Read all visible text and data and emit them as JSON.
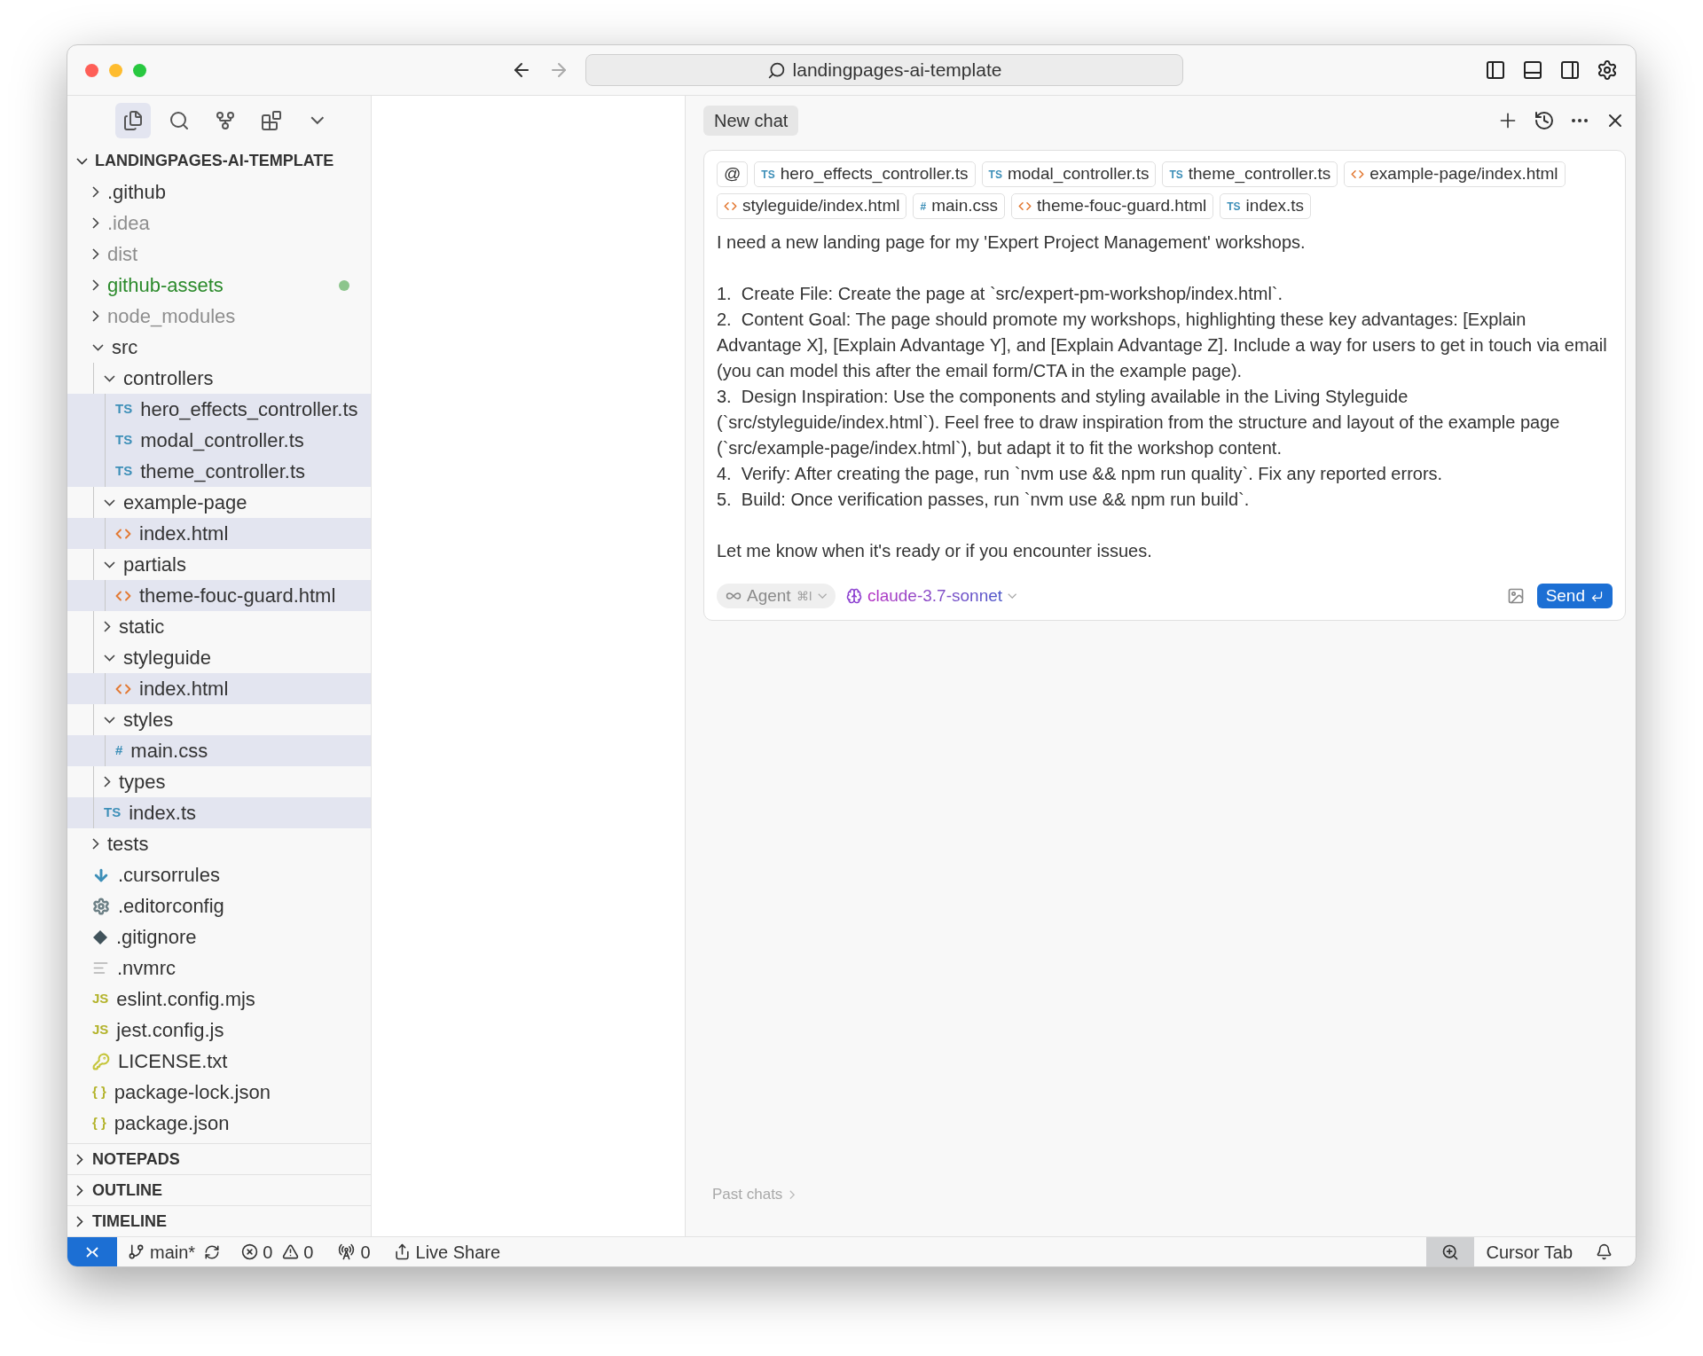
{
  "window": {
    "title": "landingpages-ai-template"
  },
  "activity_bar": [
    {
      "selected": true
    },
    {
      "selected": false
    },
    {
      "selected": false
    },
    {
      "selected": false
    },
    {
      "selected": false
    }
  ],
  "explorer": {
    "title": "LANDINGPAGES-AI-TEMPLATE",
    "expanded": true,
    "tree": [
      {
        "name": ".github",
        "kind": "folder",
        "expanded": false,
        "selected": false,
        "ignored": false,
        "untracked": false
      },
      {
        "name": ".idea",
        "kind": "folder",
        "expanded": false,
        "selected": false,
        "ignored": true,
        "untracked": false
      },
      {
        "name": "dist",
        "kind": "folder",
        "expanded": false,
        "selected": false,
        "ignored": true,
        "untracked": false
      },
      {
        "name": "github-assets",
        "kind": "folder",
        "expanded": false,
        "selected": false,
        "ignored": false,
        "untracked": true
      },
      {
        "name": "node_modules",
        "kind": "folder",
        "expanded": false,
        "selected": false,
        "ignored": true,
        "untracked": false
      },
      {
        "name": "src",
        "kind": "folder",
        "expanded": true,
        "selected": false,
        "ignored": false,
        "untracked": false,
        "children": [
          {
            "name": "controllers",
            "kind": "folder",
            "expanded": true,
            "selected": false,
            "children": [
              {
                "name": "hero_effects_controller.ts",
                "kind": "ts",
                "badge": "TS",
                "selected": true
              },
              {
                "name": "modal_controller.ts",
                "kind": "ts",
                "badge": "TS",
                "selected": true
              },
              {
                "name": "theme_controller.ts",
                "kind": "ts",
                "badge": "TS",
                "selected": true
              }
            ]
          },
          {
            "name": "example-page",
            "kind": "folder",
            "expanded": true,
            "selected": false,
            "children": [
              {
                "name": "index.html",
                "kind": "html",
                "selected": true
              }
            ]
          },
          {
            "name": "partials",
            "kind": "folder",
            "expanded": true,
            "selected": false,
            "children": [
              {
                "name": "theme-fouc-guard.html",
                "kind": "html",
                "selected": true
              }
            ]
          },
          {
            "name": "static",
            "kind": "folder",
            "expanded": false,
            "selected": false
          },
          {
            "name": "styleguide",
            "kind": "folder",
            "expanded": true,
            "selected": false,
            "children": [
              {
                "name": "index.html",
                "kind": "html",
                "selected": true
              }
            ]
          },
          {
            "name": "styles",
            "kind": "folder",
            "expanded": true,
            "selected": false,
            "children": [
              {
                "name": "main.css",
                "kind": "css",
                "badge": "#",
                "selected": true
              }
            ]
          },
          {
            "name": "types",
            "kind": "folder",
            "expanded": false,
            "selected": false
          },
          {
            "name": "index.ts",
            "kind": "ts",
            "badge": "TS",
            "selected": true
          }
        ]
      },
      {
        "name": "tests",
        "kind": "folder",
        "expanded": false,
        "selected": false,
        "ignored": false,
        "untracked": false
      },
      {
        "name": ".cursorrules",
        "kind": "rules",
        "selected": false,
        "ignored": false,
        "untracked": false
      },
      {
        "name": ".editorconfig",
        "kind": "config",
        "selected": false,
        "ignored": false,
        "untracked": false
      },
      {
        "name": ".gitignore",
        "kind": "git",
        "selected": false,
        "ignored": false,
        "untracked": false
      },
      {
        "name": ".nvmrc",
        "kind": "text",
        "selected": false,
        "ignored": false,
        "untracked": false
      },
      {
        "name": "eslint.config.mjs",
        "kind": "js",
        "badge": "JS",
        "selected": false,
        "ignored": false,
        "untracked": false
      },
      {
        "name": "jest.config.js",
        "kind": "js",
        "badge": "JS",
        "selected": false,
        "ignored": false,
        "untracked": false
      },
      {
        "name": "LICENSE.txt",
        "kind": "license",
        "selected": false,
        "ignored": false,
        "untracked": false
      },
      {
        "name": "package-lock.json",
        "kind": "json",
        "badge": "{ }",
        "selected": false,
        "ignored": false,
        "untracked": false
      },
      {
        "name": "package.json",
        "kind": "json",
        "badge": "{ }",
        "selected": false,
        "ignored": false,
        "untracked": false
      }
    ]
  },
  "sections": [
    {
      "title": "NOTEPADS",
      "expanded": false
    },
    {
      "title": "OUTLINE",
      "expanded": false
    },
    {
      "title": "TIMELINE",
      "expanded": false
    }
  ],
  "chat": {
    "tab": "New chat",
    "context_chips": [
      {
        "kind": "mention",
        "label": "@"
      },
      {
        "kind": "ts",
        "badge": "TS",
        "label": "hero_effects_controller.ts"
      },
      {
        "kind": "ts",
        "badge": "TS",
        "label": "modal_controller.ts"
      },
      {
        "kind": "ts",
        "badge": "TS",
        "label": "theme_controller.ts"
      },
      {
        "kind": "html",
        "label": "example-page/index.html"
      },
      {
        "kind": "html",
        "label": "styleguide/index.html"
      },
      {
        "kind": "css",
        "badge": "#",
        "label": "main.css"
      },
      {
        "kind": "html",
        "label": "theme-fouc-guard.html"
      },
      {
        "kind": "ts",
        "badge": "TS",
        "label": "index.ts"
      }
    ],
    "message": [
      [
        "I need a new landing page for my 'Expert Project Management' workshops."
      ],
      [
        "1.  Create File: Create the page at `src/expert-pm-workshop/index.html`.",
        "2.  Content Goal: The page should promote my workshops, highlighting these key advantages: [Explain Advantage X], [Explain Advantage Y], and [Explain Advantage Z]. Include a way for users to get in touch via email (you can model this after the email form/CTA in the example page).",
        "3.  Design Inspiration: Use the components and styling available in the Living Styleguide (`src/styleguide/index.html`). Feel free to draw inspiration from the structure and layout of the example page (`src/example-page/index.html`), but adapt it to fit the workshop content.",
        "4.  Verify: After creating the page, run `nvm use && npm run quality`. Fix any reported errors.",
        "5.  Build: Once verification passes, run `nvm use && npm run build`."
      ],
      [
        "Let me know when it's ready or if you encounter issues."
      ]
    ],
    "mode": {
      "label": "Agent",
      "shortcut": "⌘I"
    },
    "model": "claude-3.7-sonnet",
    "send": "Send",
    "past_chats": "Past chats"
  },
  "status_bar": {
    "branch": "main*",
    "errors": "0",
    "warnings": "0",
    "ports": "0",
    "live_share": "Live Share",
    "cursor_tab": "Cursor Tab"
  }
}
